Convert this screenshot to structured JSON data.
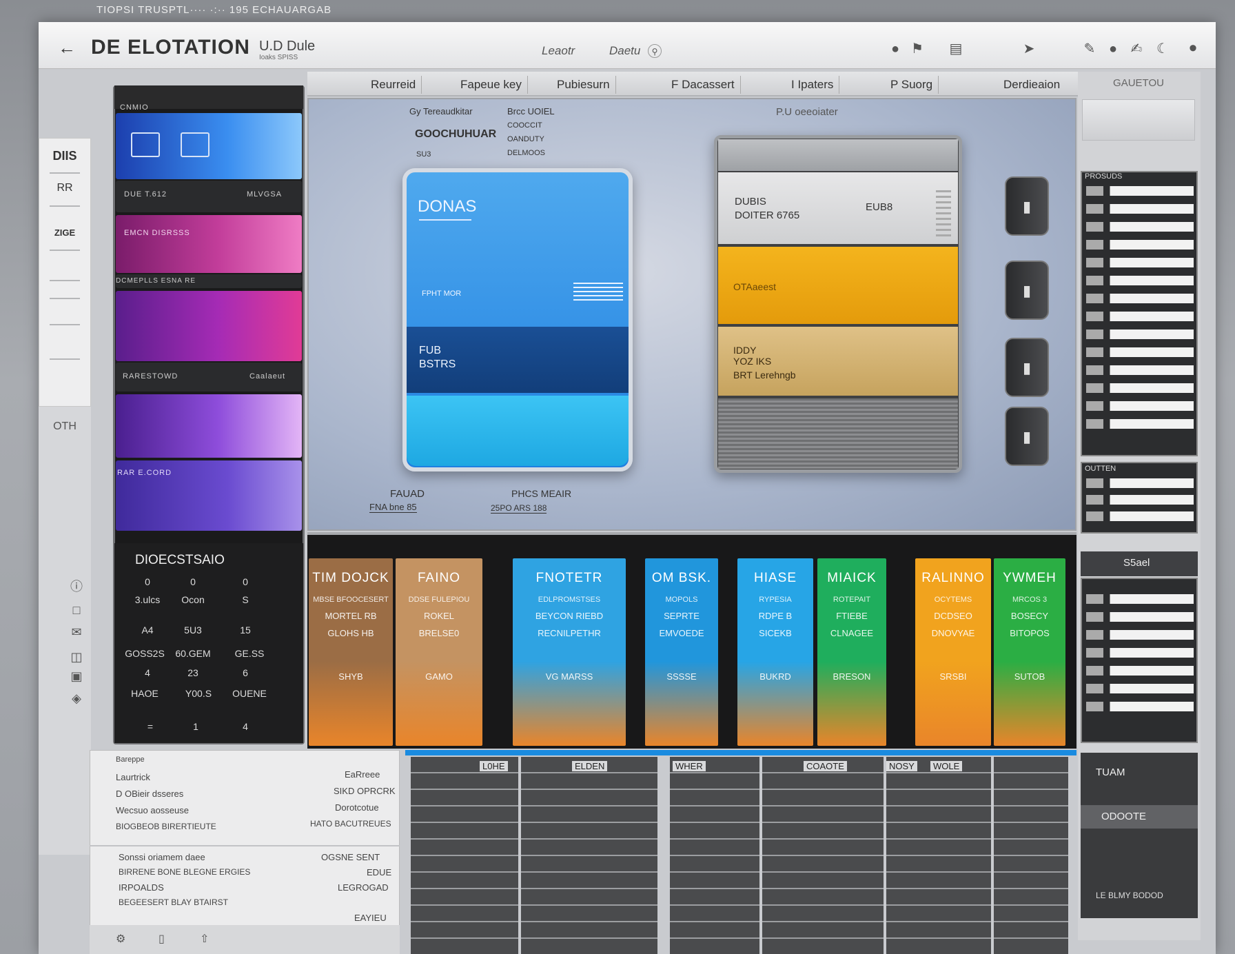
{
  "caption": "TIOPSI TRUSPTL···· ·:·· 195   ECHAUARGAB",
  "titlebar": {
    "title": "DE ELOTATION",
    "subtitle": "U.D  Dule",
    "subtitle_small": "Ioaks SPISS",
    "center_left": "Leaotr",
    "center_right": "Daetu"
  },
  "tabs": [
    "Reurreid",
    "Fapeue  key",
    "Pubiesurn",
    "F  Dacassert",
    "I Ipaters",
    "P Suorg",
    "Derdieaion"
  ],
  "right_header": "GAUETOU",
  "rail": [
    "DIIS",
    "RR",
    "ZIGE",
    "OTH"
  ],
  "stack": {
    "labels": [
      "CNMIO",
      "DUE T.612",
      "MLVGSA",
      "EMCN DISRSSS",
      "DCMEPLLS ESNA RE",
      "RARESTOWD",
      "Caalaeut",
      "RAR E.CORD"
    ]
  },
  "calc": {
    "title": "DIOECSTSAIO",
    "keys": [
      "0",
      "0",
      "0",
      "3.ulcs",
      "Ocon",
      "S",
      "A4",
      "5U3",
      "15",
      "GOSS2S",
      "60.GEM",
      "GE.SS",
      "4",
      "23",
      "6",
      "HAOE",
      "Y00.S",
      "OUENE",
      "=",
      "1",
      "4"
    ]
  },
  "panel": {
    "top_left": [
      "Gy Tereaudkitar",
      "GOOCHUHUAR",
      "SU3"
    ],
    "top_mid": [
      "Brcc UOIEL",
      "COOCCIT",
      "OANDUTY",
      "DELMOOS"
    ],
    "top_right": "P.U oeeoiater",
    "blue": {
      "title": "DONAS",
      "mid1": "FUB",
      "mid2": "BSTRS",
      "note": "FPHT MOR"
    },
    "stack": {
      "grey1": "DUBIS",
      "grey2": "DOITER 6765",
      "grey3": "EUB8",
      "yellow": "OTAaeest",
      "tan1": "IDDY",
      "tan2": "YOZ IKS",
      "tan3": "BRT Lerehngb"
    },
    "bottom_left": [
      "FAUAD",
      "FNA bne 85"
    ],
    "bottom_right": [
      "PHCS MEAIR",
      "25PO ARS 188"
    ]
  },
  "right_grid_label_1": "PROSUDS",
  "right_grid_label_2": "OUTTEN",
  "right_grid_label_3": "S5ael",
  "books": [
    {
      "title": "TIM DOJCK",
      "s1": "MBSE BFOOCESERT",
      "s2": "MORTEL RB",
      "s3": "GLOHS HB",
      "s4": "SHYB",
      "color": "#9b6d45"
    },
    {
      "title": "FAINO",
      "s1": "DDSE FULEPIOU",
      "s2": "ROKEL",
      "s3": "BRELSE0",
      "s4": "GAMO",
      "color": "#c49362"
    },
    {
      "title": "FNOTETR",
      "s1": "EDLPROMSTSES",
      "s2": "BEYCON RIEBD",
      "s3": "RECNILPETHR",
      "s4": "VG  MARSS",
      "color": "#2fa3e2"
    },
    {
      "title": "OM BSK.",
      "s1": "MOPOLS",
      "s2": "SEPRTE",
      "s3": "EMVOEDE",
      "s4": "SSSSE",
      "color": "#2196dc"
    },
    {
      "title": "HIASE",
      "s1": "RYPESIA",
      "s2": "RDPE B",
      "s3": "SICEKB",
      "s4": "BUKRD",
      "color": "#27a5e6"
    },
    {
      "title": "MIAICK",
      "s1": "ROTEPAIT",
      "s2": "FTIEBE",
      "s3": "CLNAGEE",
      "s4": "BRESON",
      "color": "#1fae5d"
    },
    {
      "title": "RALINNO",
      "s1": "OCYTEMS",
      "s2": "DCDSEO",
      "s3": "DNOVYAE",
      "s4": "SRSBI",
      "color": "#f1a31e"
    },
    {
      "title": "YWMEH",
      "s1": "MRCOS 3",
      "s2": "BOSECY",
      "s3": "BITOPOS",
      "s4": "SUTOB",
      "color": "#2bae44"
    }
  ],
  "bottom_left": [
    [
      "Bareppe",
      ""
    ],
    [
      "Laurtrick",
      "EaRreee"
    ],
    [
      "D OBieir dsseres",
      "SIKD OPRCRK"
    ],
    [
      "Wecsuo aosseuse",
      "Dorotcotue"
    ],
    [
      "BIOGBEOB BIRERTIEUTE",
      "HATO  BACUTREUES"
    ],
    [
      "Sonssi oriamem daee",
      "OGSNE SENT"
    ],
    [
      "BIRRENE BONE BLEGNE ERGIES",
      "EDUE"
    ],
    [
      "IRPOALDS",
      "LEGROGAD"
    ],
    [
      "BEGEESERT BLAY BTAIRST",
      "EAYIEU"
    ]
  ],
  "bottom_headers": [
    "L0HE",
    "ELDEN",
    "WHER",
    "COAOTE",
    "NOSY",
    "WOLE"
  ],
  "right_bottom": {
    "title": "TUAM",
    "label": "ODOOTE",
    "note": "LE  BLMY  BODOD"
  },
  "colors": {
    "accent": "#1a8be0",
    "window": "#c9cbcf"
  }
}
